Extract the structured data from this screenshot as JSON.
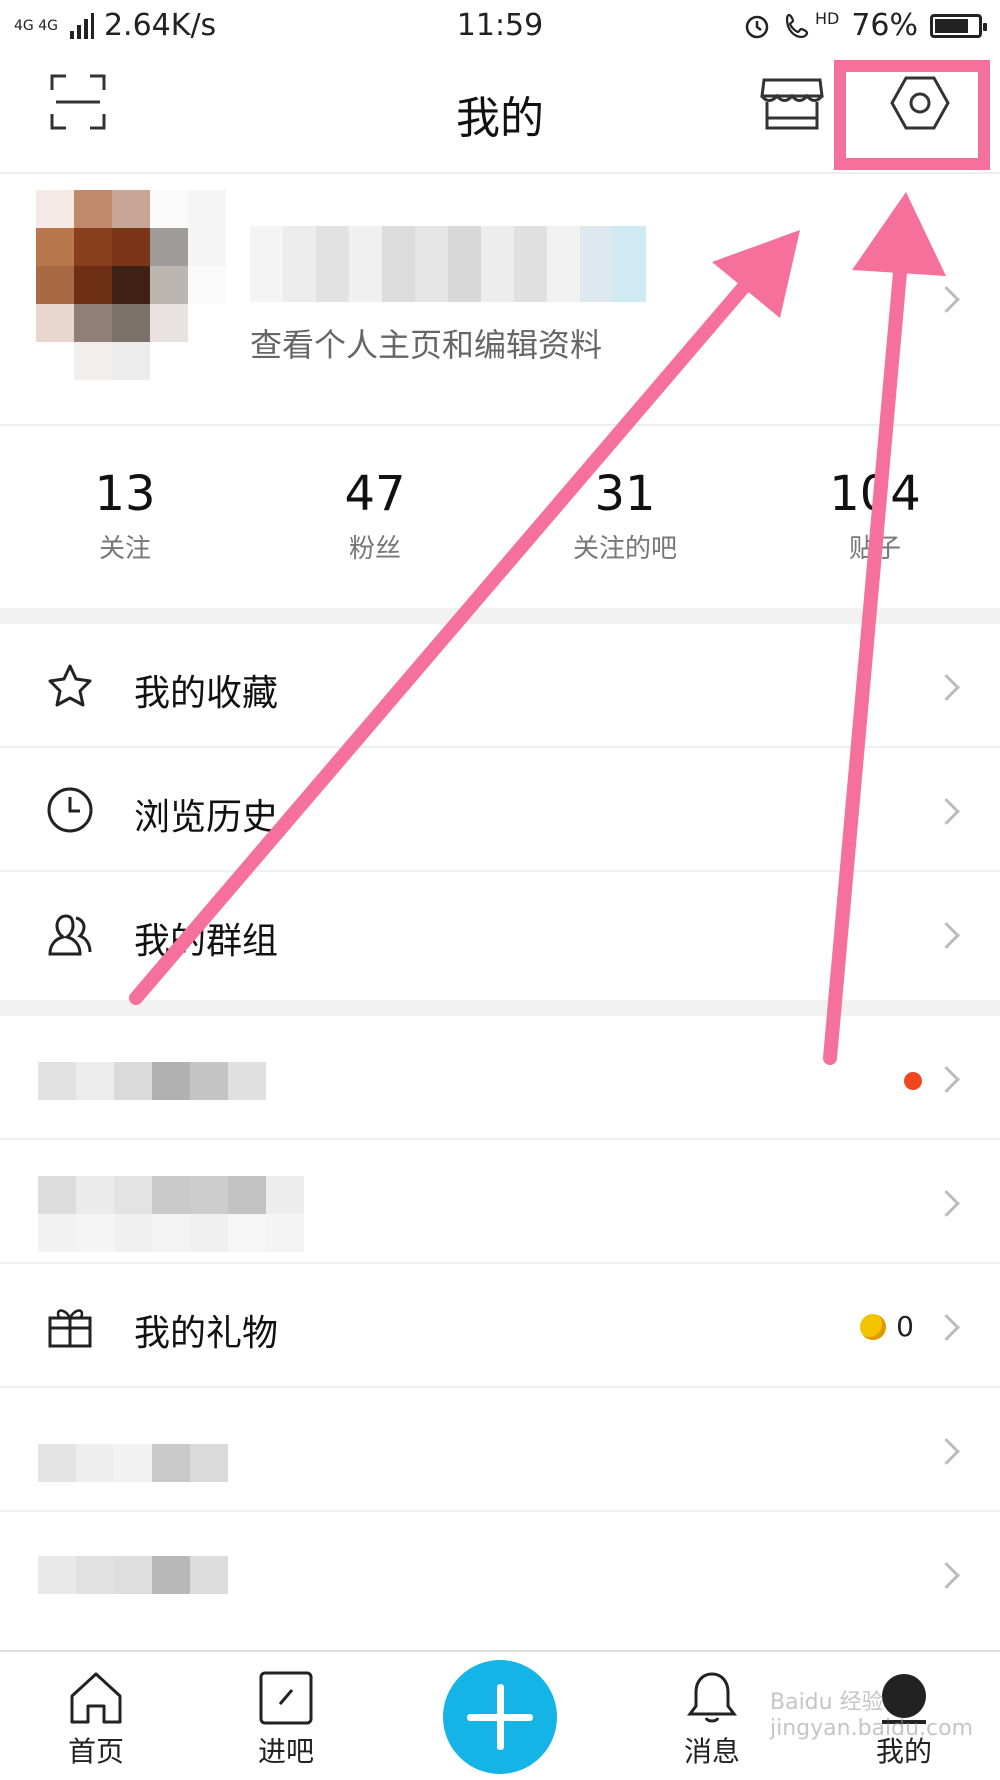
{
  "status_bar": {
    "network": "4G 4G",
    "speed": "2.64K/s",
    "time": "11:59",
    "hd": "HD",
    "battery": "76%",
    "battery_level": 0.76
  },
  "header": {
    "title": "我的"
  },
  "profile": {
    "subtitle": "查看个人主页和编辑资料"
  },
  "stats": [
    {
      "value": "13",
      "label": "关注"
    },
    {
      "value": "47",
      "label": "粉丝"
    },
    {
      "value": "31",
      "label": "关注的吧"
    },
    {
      "value": "104",
      "label": "贴子"
    }
  ],
  "menu": {
    "favorites": "我的收藏",
    "history": "浏览历史",
    "groups": "我的群组",
    "gifts": "我的礼物",
    "gift_count": "0"
  },
  "tabbar": {
    "home": "首页",
    "enter": "进吧",
    "messages": "消息",
    "mine": "我的"
  },
  "watermark": "Baidu 经验 jingyan.baidu.com",
  "colors": {
    "accent": "#14b4e6",
    "annotation": "#f5709a",
    "badge": "#f0461e"
  }
}
